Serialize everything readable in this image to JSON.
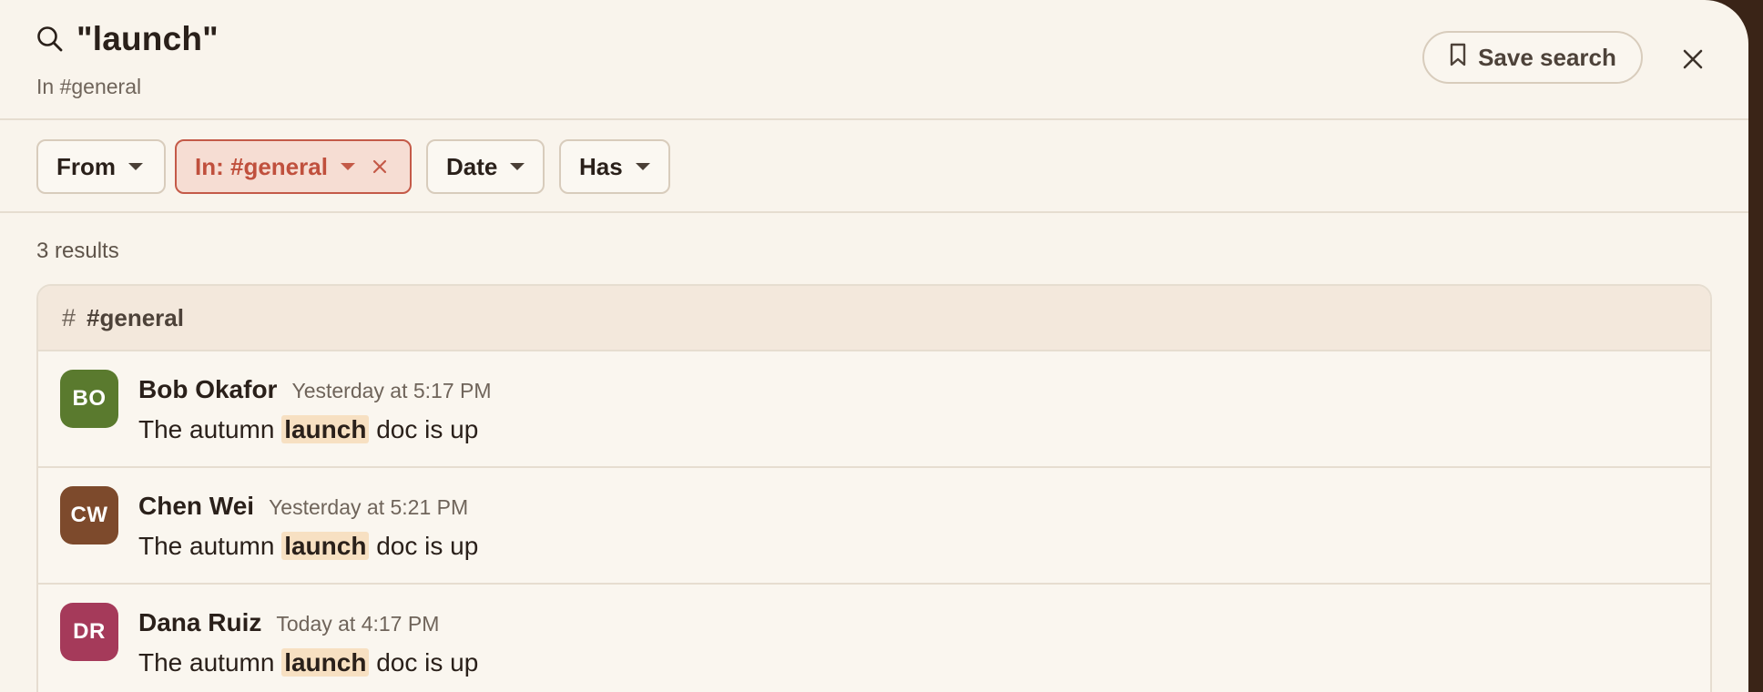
{
  "search": {
    "query": "\"launch\"",
    "scope": "In #general",
    "save_label": "Save search"
  },
  "filters": [
    {
      "label": "From",
      "active": false
    },
    {
      "label": "In: #general",
      "active": true
    },
    {
      "label": "Date",
      "active": false
    },
    {
      "label": "Has",
      "active": false
    }
  ],
  "results": {
    "count_label": "3 results",
    "group": "#general",
    "group_icon": "hash-icon",
    "messages": [
      {
        "initials": "BO",
        "name": "Bob Okafor",
        "time": "Yesterday at 5:17 PM",
        "pre": "The autumn ",
        "match": "launch",
        "post": " doc is up",
        "avatar_color": "#5a7a2e"
      },
      {
        "initials": "CW",
        "name": "Chen Wei",
        "time": "Yesterday at 5:21 PM",
        "pre": "The autumn ",
        "match": "launch",
        "post": " doc is up",
        "avatar_color": "#7d4a2c"
      },
      {
        "initials": "DR",
        "name": "Dana Ruiz",
        "time": "Today at 4:17 PM",
        "pre": "The autumn ",
        "match": "launch",
        "post": " doc is up",
        "avatar_color": "#a53a5a"
      }
    ]
  },
  "colors": {
    "accent": "#c45a48",
    "highlight": "#f7e0c2",
    "background": "#f9f4ec"
  }
}
